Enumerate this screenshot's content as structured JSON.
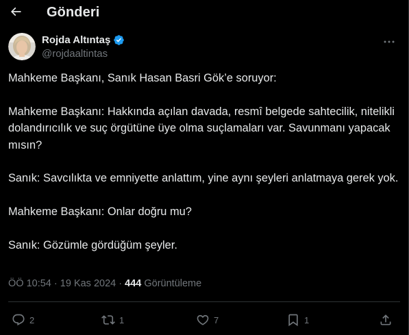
{
  "header": {
    "title": "Gönderi",
    "back_icon": "arrow-left-icon"
  },
  "author": {
    "name": "Rojda Altıntaş",
    "handle": "@rojdaaltintas",
    "verified_icon": "verified-badge-icon",
    "verified_color": "#1d9bf0"
  },
  "tweet": {
    "paragraphs": [
      "Mahkeme Başkanı, Sanık Hasan Basri Gök’e soruyor:",
      "Mahkeme Başkanı: Hakkında açılan davada, resmî belgede sahtecilik, nitelikli dolandırıcılık ve suç örgütüne üye olma suçlamaları var. Savunmanı yapacak mısın?",
      "Sanık: Savcılıkta ve emniyette anlattım, yine aynı şeyleri anlatmaya gerek yok.",
      "Mahkeme Başkanı: Onlar doğru mu?",
      "Sanık: Gözümle gördüğüm şeyler."
    ]
  },
  "meta": {
    "time": "ÖÖ 10:54",
    "separator": "·",
    "date": "19 Kas 2024",
    "views_count": "444",
    "views_label": "Görüntüleme"
  },
  "actions": {
    "reply_count": "2",
    "repost_count": "1",
    "like_count": "7",
    "bookmark_count": "1"
  },
  "colors": {
    "background": "#000000",
    "text": "#e7e9ea",
    "secondary": "#71767b",
    "border": "#2f3336",
    "accent": "#1d9bf0"
  }
}
